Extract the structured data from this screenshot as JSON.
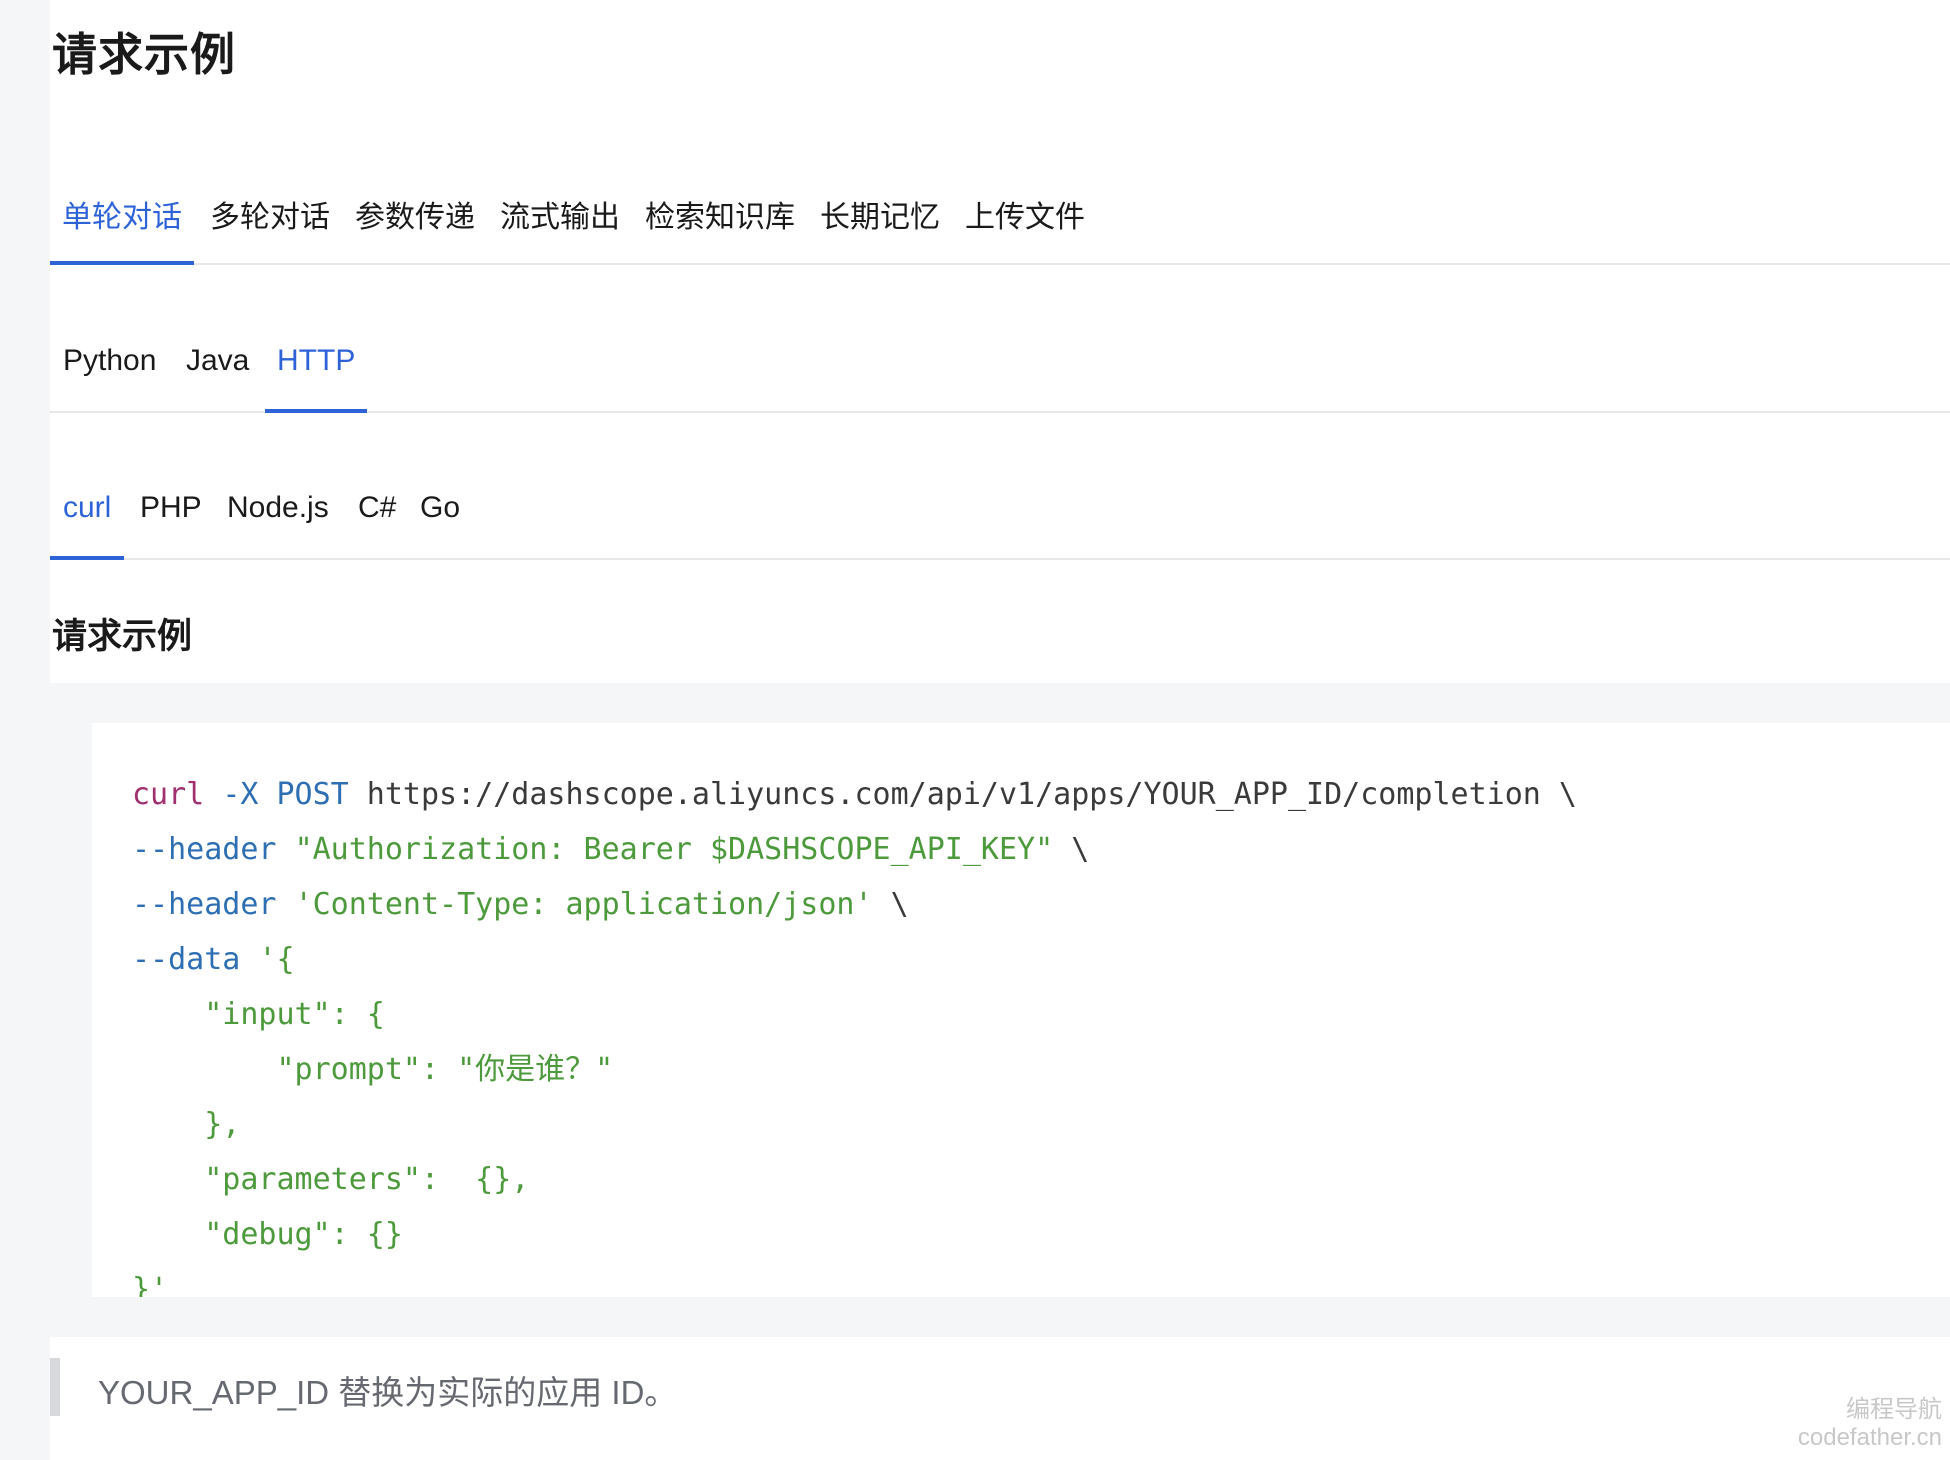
{
  "heading": "请求示例",
  "scenario_tabs": {
    "active": 0,
    "items": [
      "单轮对话",
      "多轮对话",
      "参数传递",
      "流式输出",
      "检索知识库",
      "长期记忆",
      "上传文件"
    ]
  },
  "language_tabs": {
    "active": 2,
    "items": [
      "Python",
      "Java",
      "HTTP"
    ]
  },
  "client_tabs": {
    "active": 0,
    "items": [
      "curl",
      "PHP",
      "Node.js",
      "C#",
      "Go"
    ]
  },
  "example": {
    "title": "请求示例",
    "code_lines": [
      [
        {
          "t": "kw",
          "v": "curl"
        },
        {
          "t": "pl",
          "v": " "
        },
        {
          "t": "opt",
          "v": "-X POST"
        },
        {
          "t": "pl",
          "v": " https://dashscope.aliyuncs.com/api/v1/apps/YOUR_APP_ID/completion \\"
        }
      ],
      [
        {
          "t": "opt",
          "v": "--header"
        },
        {
          "t": "pl",
          "v": " "
        },
        {
          "t": "str",
          "v": "\"Authorization: Bearer $DASHSCOPE_API_KEY\""
        },
        {
          "t": "pl",
          "v": " \\"
        }
      ],
      [
        {
          "t": "opt",
          "v": "--header"
        },
        {
          "t": "pl",
          "v": " "
        },
        {
          "t": "str",
          "v": "'Content-Type: application/json'"
        },
        {
          "t": "pl",
          "v": " \\"
        }
      ],
      [
        {
          "t": "opt",
          "v": "--data"
        },
        {
          "t": "pl",
          "v": " "
        },
        {
          "t": "str",
          "v": "'{"
        }
      ],
      [
        {
          "t": "str",
          "v": "    \"input\": {"
        }
      ],
      [
        {
          "t": "str",
          "v": "        \"prompt\": \"你是谁？\""
        }
      ],
      [
        {
          "t": "str",
          "v": "    },"
        }
      ],
      [
        {
          "t": "str",
          "v": "    \"parameters\":  {},"
        }
      ],
      [
        {
          "t": "str",
          "v": "    \"debug\": {}"
        }
      ],
      [
        {
          "t": "str",
          "v": "}'"
        }
      ]
    ]
  },
  "note": "YOUR_APP_ID 替换为实际的应用 ID。",
  "watermark": {
    "line1": "编程导航",
    "line2": "codefather.cn"
  },
  "colors": {
    "accent": "#2e63d8",
    "keyword": "#a0306f",
    "option": "#2e6fb3",
    "string": "#4d9a3c"
  }
}
